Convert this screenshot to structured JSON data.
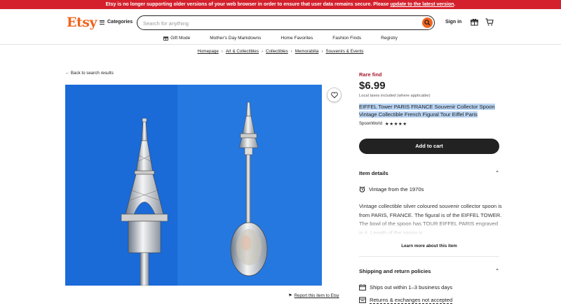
{
  "banner": {
    "text": "Etsy is no longer supporting older versions of your web browser in order to ensure that user data remains secure. Please ",
    "link": "update to the latest version",
    "end": "."
  },
  "header": {
    "logo": "Etsy",
    "categories": "Categories",
    "search_placeholder": "Search for anything",
    "signin": "Sign in"
  },
  "subnav": [
    {
      "label": "Gift Mode",
      "icon": "gift-icon"
    },
    {
      "label": "Mother's Day Markdowns"
    },
    {
      "label": "Home Favorites"
    },
    {
      "label": "Fashion Finds"
    },
    {
      "label": "Registry"
    }
  ],
  "breadcrumb": [
    "Homepage",
    "Art & Collectibles",
    "Collectibles",
    "Memorabilia",
    "Souvenirs & Events"
  ],
  "back_link": "Back to search results",
  "report_link": "Report this item to Etsy",
  "product": {
    "badge": "Rare find",
    "price": "$6.99",
    "taxes": "Local taxes included (where applicable)",
    "title": "EIFFEL Tower PARIS FRANCE Souvenir Collector Spoon Vintage Collectible French Figural Tour Eiffel Paris",
    "shop": "SpoonWorld",
    "stars": "★★★★★",
    "add_to_cart": "Add to cart"
  },
  "item_details": {
    "heading": "Item details",
    "vintage": "Vintage from the 1970s",
    "description": "Vintage collectible silver coloured souvenir collector spoon is from PARIS, FRANCE. The figural is of the EIFFEL TOWER. The bowl of the spoon has TOUR EIFFEL PARIS engraved in it. Length of the spoon is",
    "learn_more": "Learn more about this item"
  },
  "shipping": {
    "heading": "Shipping and return policies",
    "ships": "Ships out within 1–3 business days",
    "returns": "Returns & exchanges not accepted"
  },
  "colors": {
    "brand": "#f1641e",
    "banner": "#d3202c",
    "rare": "#a61a2e",
    "photo_bg": "#1e6fd9"
  }
}
